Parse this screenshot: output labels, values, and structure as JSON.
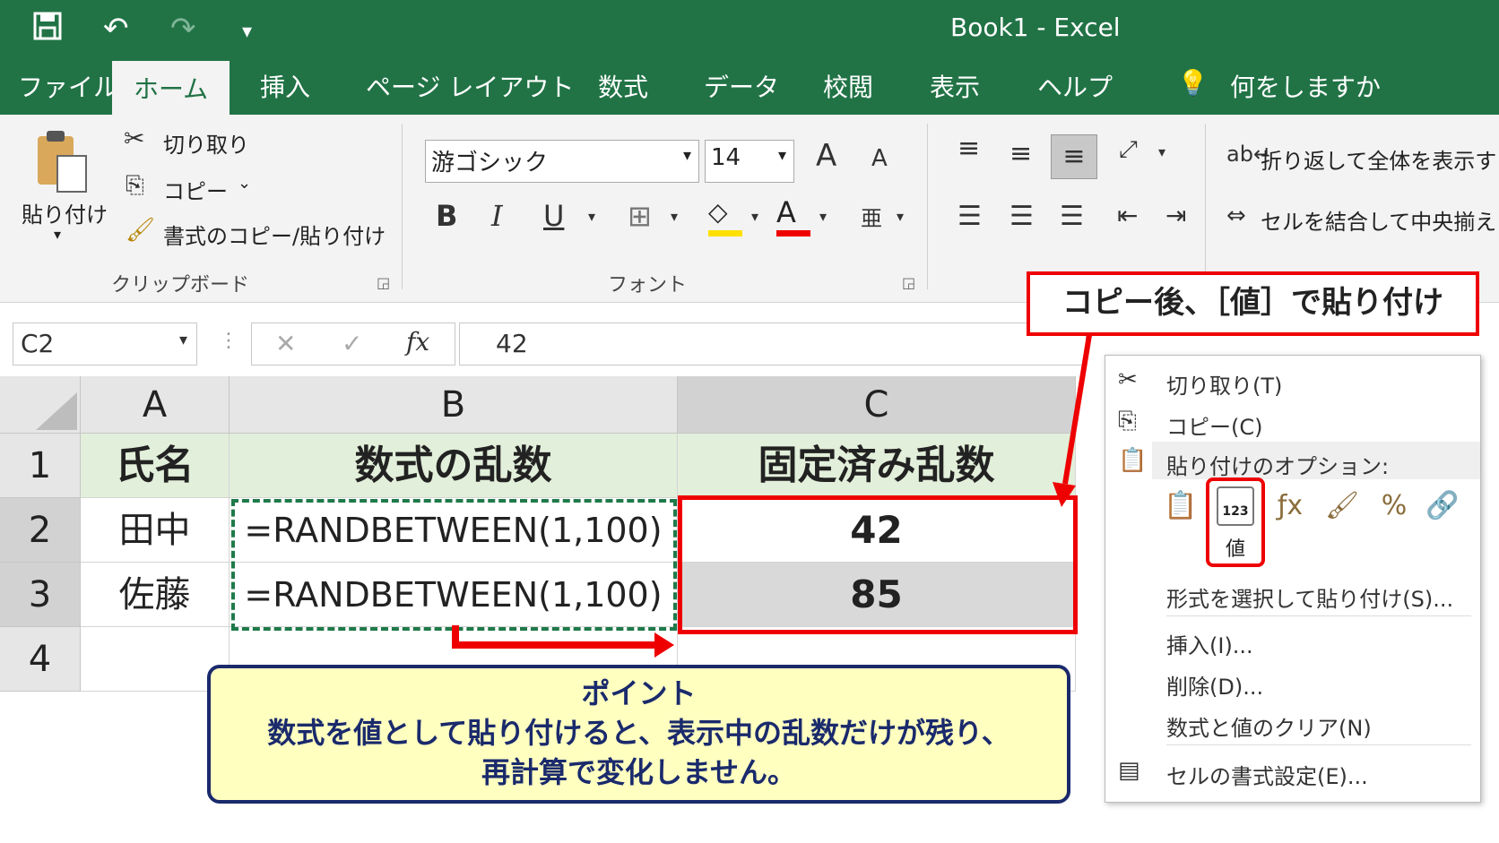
{
  "quick_access": {
    "save_icon": "save-icon",
    "undo_icon": "undo-icon",
    "redo_icon": "redo-icon",
    "customize_icon": "customize-qat-icon"
  },
  "window": {
    "title": "Book1  -  Excel"
  },
  "tabs": [
    "ファイル",
    "ホーム",
    "挿入",
    "ページ レイアウト",
    "数式",
    "データ",
    "校閲",
    "表示",
    "ヘルプ"
  ],
  "tell_me": {
    "placeholder": "何をしますか",
    "icon": "lightbulb-icon"
  },
  "clipboard": {
    "paste_label": "貼り付け",
    "cut_label": "切り取り",
    "copy_label": "コピー",
    "format_painter_label": "書式のコピー/貼り付け",
    "group_label": "クリップボード"
  },
  "font": {
    "name": "游ゴシック",
    "size": "14",
    "bold": "B",
    "italic": "I",
    "underline": "U",
    "font_color_letter": "A",
    "grow_letter": "A",
    "shrink_letter": "A",
    "group_label": "フォント"
  },
  "alignment": {
    "wrap_text_label": "折り返して全体を表示する",
    "merge_center_label": "セルを結合して中央揃え"
  },
  "formula_bar": {
    "name_box": "C2",
    "fx": "fx",
    "value": "42",
    "cancel": "✕",
    "enter": "✓"
  },
  "grid": {
    "columns": [
      "A",
      "B",
      "C"
    ],
    "rows": [
      "1",
      "2",
      "3",
      "4"
    ],
    "cells": [
      [
        "氏名",
        "数式の乱数",
        "固定済み乱数"
      ],
      [
        "田中",
        "=RANDBETWEEN(1,100)",
        "42"
      ],
      [
        "佐藤",
        "=RANDBETWEEN(1,100)",
        "85"
      ]
    ]
  },
  "callouts": {
    "paste_values": "コピー後、［値］で貼り付け",
    "point_title": "ポイント",
    "point_line1": "数式を値として貼り付けると、表示中の乱数だけが残り、",
    "point_line2": "再計算で変化しません。"
  },
  "context_menu": {
    "cut": "切り取り(T)",
    "copy": "コピー(C)",
    "paste_options": "貼り付けのオプション:",
    "values_label": "値",
    "values_badge": "123",
    "paste_special": "形式を選択して貼り付け(S)...",
    "insert": "挿入(I)...",
    "delete": "削除(D)...",
    "clear_contents": "数式と値のクリア(N)",
    "format_cells": "セルの書式設定(E)..."
  },
  "colors": {
    "excel_green": "#217346",
    "highlight_red": "#e00000",
    "header_fill": "#e2efda",
    "note_fill": "#ffffc0",
    "note_border": "#1a2a6c"
  }
}
